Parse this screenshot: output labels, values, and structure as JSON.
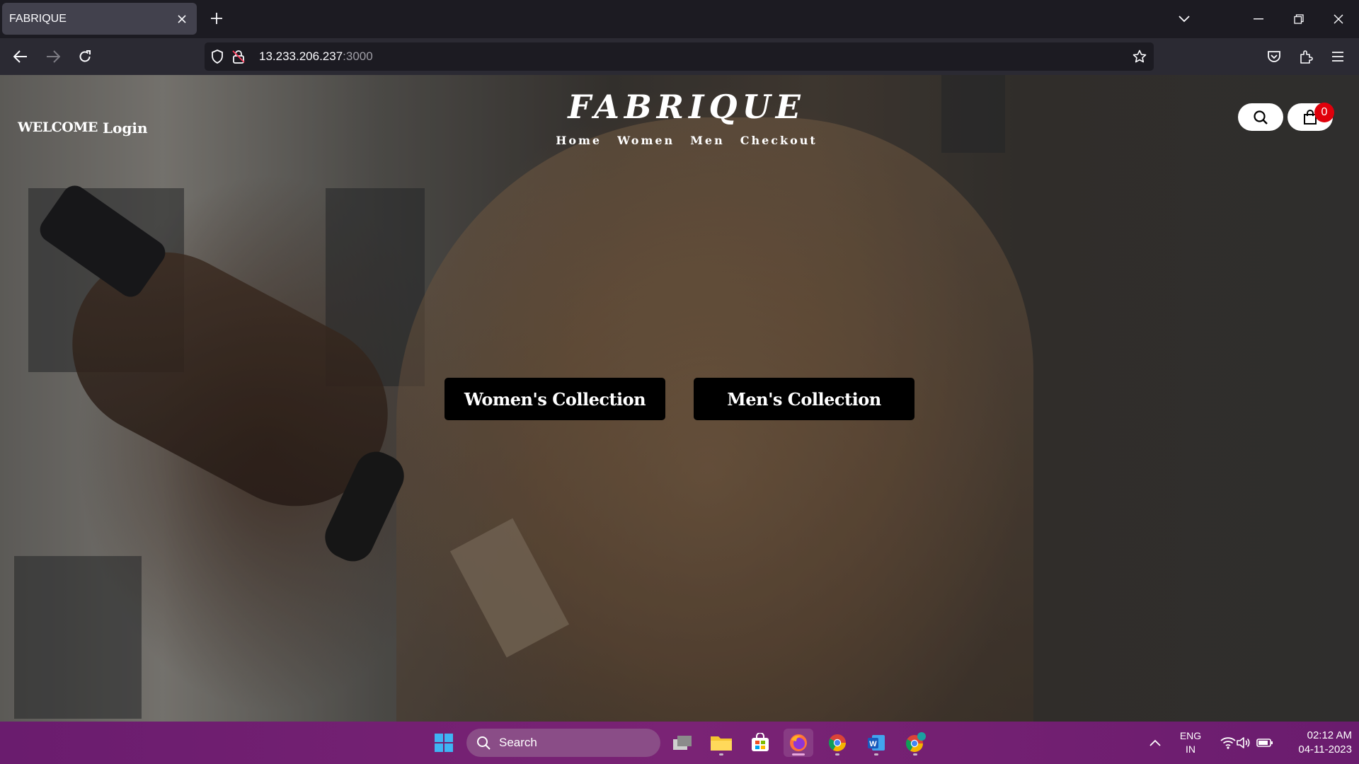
{
  "browser": {
    "tab_title": "FABRIQUE",
    "url_host": "13.233.206.237",
    "url_port": ":3000"
  },
  "site": {
    "welcome": "WELCOME",
    "login": "Login",
    "logo": "FABRIQUE",
    "nav": [
      "Home",
      "Women",
      "Men",
      "Checkout"
    ],
    "cart_count": "0",
    "cta_women": "Women's Collection",
    "cta_men": "Men's Collection"
  },
  "taskbar": {
    "search_placeholder": "Search",
    "lang": "ENG",
    "region": "IN",
    "time": "02:12 AM",
    "date": "04-11-2023"
  },
  "colors": {
    "tab_bar": "#1c1b22",
    "nav_bar": "#2b2a33",
    "badge": "#e0000b",
    "taskbar": "#6a1c6e"
  }
}
